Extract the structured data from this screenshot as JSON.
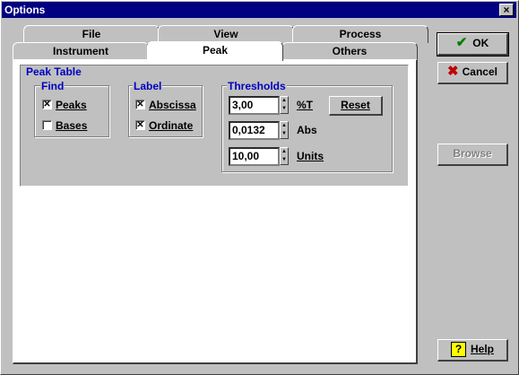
{
  "window": {
    "title": "Options",
    "close_label": "×"
  },
  "tabs": {
    "row_back": [
      {
        "label": "File"
      },
      {
        "label": "View"
      },
      {
        "label": "Process"
      }
    ],
    "row_front": [
      {
        "label": "Instrument"
      },
      {
        "label": "Peak"
      },
      {
        "label": "Others"
      }
    ],
    "active": "Peak"
  },
  "peak_table": {
    "title": "Peak Table",
    "find": {
      "title": "Find",
      "peaks": {
        "label": "Peaks",
        "checked": true
      },
      "bases": {
        "label": "Bases",
        "checked": false
      }
    },
    "label_group": {
      "title": "Label",
      "abscissa": {
        "label": "Abscissa",
        "checked": true
      },
      "ordinate": {
        "label": "Ordinate",
        "checked": true
      }
    },
    "thresholds": {
      "title": "Thresholds",
      "percent_t": {
        "value": "3,00",
        "label": "%T"
      },
      "abs": {
        "value": "0,0132",
        "label": "Abs"
      },
      "units": {
        "value": "10,00",
        "label": "Units"
      },
      "reset_label": "Reset"
    }
  },
  "buttons": {
    "ok": "OK",
    "cancel": "Cancel",
    "browse": "Browse",
    "help": "Help"
  },
  "colors": {
    "title_bar": "#000080",
    "group_title": "#0000c0",
    "ok_check": "#008000",
    "cancel_x": "#c00000",
    "help_icon": "#ffff00"
  }
}
